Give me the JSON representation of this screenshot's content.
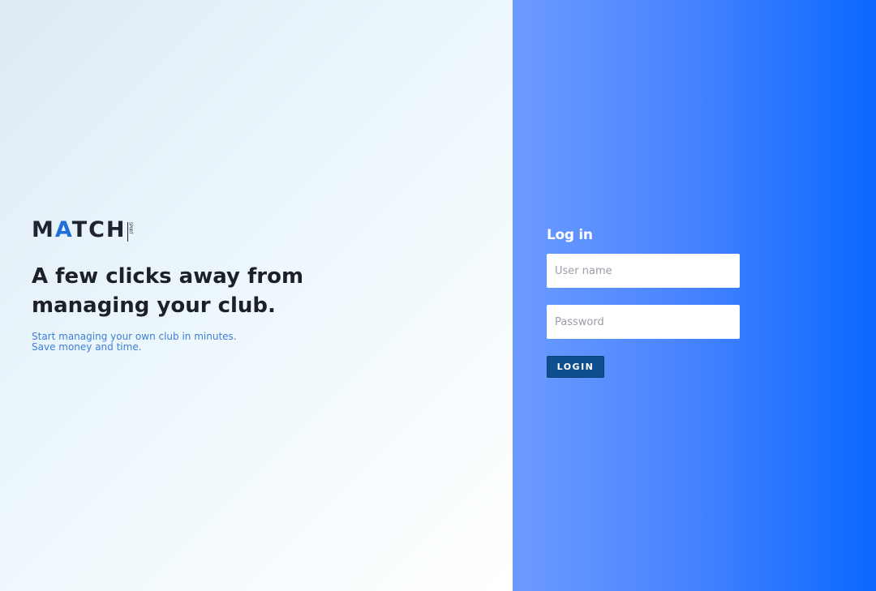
{
  "brand": {
    "logo_main": "MAT",
    "logo_accent": "",
    "logo_m": "M",
    "logo_a": "A",
    "logo_rest": "TCH",
    "logo_tag": "SPORT"
  },
  "hero": {
    "headline": "A few clicks away from managing your club.",
    "sub_line_1": "Start managing your own club in minutes.",
    "sub_line_2": "Save money and time."
  },
  "login": {
    "title": "Log in",
    "username_placeholder": "User name",
    "password_placeholder": "Password",
    "button_label": "LOGIN"
  },
  "colors": {
    "accent": "#1e6fd9",
    "panel_gradient_start": "#6d9bff",
    "panel_gradient_end": "#0a68ff",
    "button": "#0d4f8f"
  }
}
